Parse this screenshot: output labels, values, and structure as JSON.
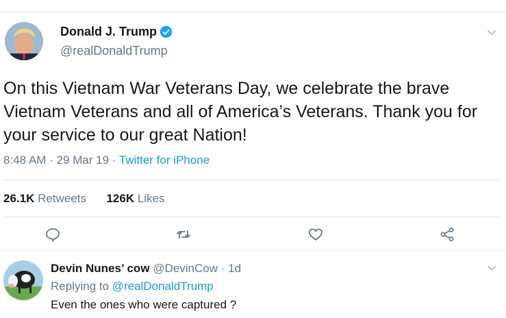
{
  "tweet": {
    "display_name": "Donald J. Trump",
    "handle": "@realDonaldTrump",
    "text": "On this Vietnam War Veterans Day, we celebrate the brave Vietnam Veterans and all of America’s Veterans. Thank you for your service to our great Nation!",
    "time": "8:48 AM",
    "date": "29 Mar 19",
    "source": "Twitter for iPhone",
    "dot": "·"
  },
  "stats": {
    "retweets_count": "26.1K",
    "retweets_label": "Retweets",
    "likes_count": "126K",
    "likes_label": "Likes"
  },
  "icons": {
    "verified": "verified-badge-icon",
    "chevron": "chevron-down-icon",
    "reply": "reply-icon",
    "retweet": "retweet-icon",
    "like": "heart-icon",
    "share": "share-icon"
  },
  "reply": {
    "display_name": "Devin Nunes’ cow",
    "handle": "@DevinCow",
    "time": "1d",
    "dot": "·",
    "replying_prefix": "Replying to",
    "replying_to": "@realDonaldTrump",
    "text": "Even the ones who were captured ?"
  },
  "colors": {
    "link": "#1b95e0",
    "secondary_text": "#657786",
    "divider": "#e1e8ed",
    "verified": "#1da1f2"
  }
}
